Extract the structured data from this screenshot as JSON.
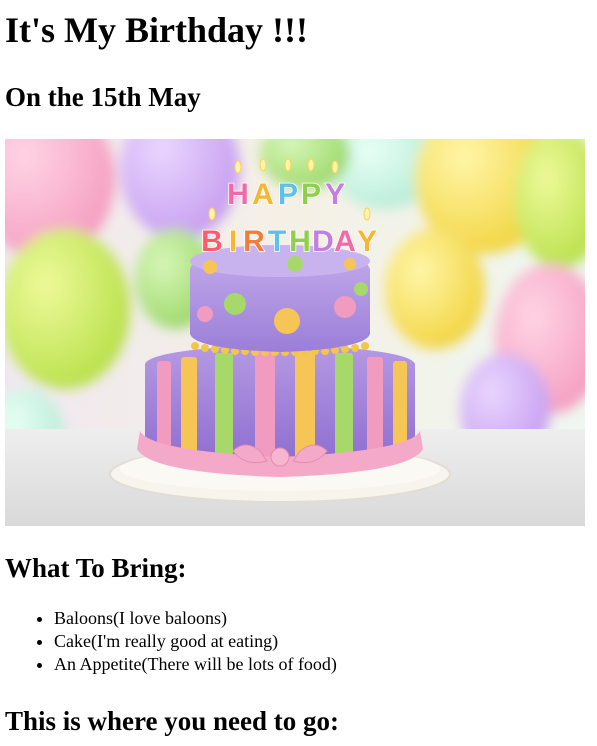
{
  "page": {
    "title": "It's My Birthday !!!",
    "date_heading": "On the 15th May",
    "bring_heading": "What To Bring:",
    "bring_items": [
      "Baloons(I love baloons)",
      "Cake(I'm really good at eating)",
      "An Appetite(There will be lots of food)"
    ],
    "directions_heading": "This is where you need to go:"
  },
  "photo": {
    "topper_top": "HAPPY",
    "topper_bottom": "BIRTHDAY",
    "letter_colors": [
      "#f06aa8",
      "#f5b731",
      "#5fc1e8",
      "#8fd04b",
      "#f07d3b",
      "#c47ee0",
      "#ff5a6e"
    ]
  }
}
